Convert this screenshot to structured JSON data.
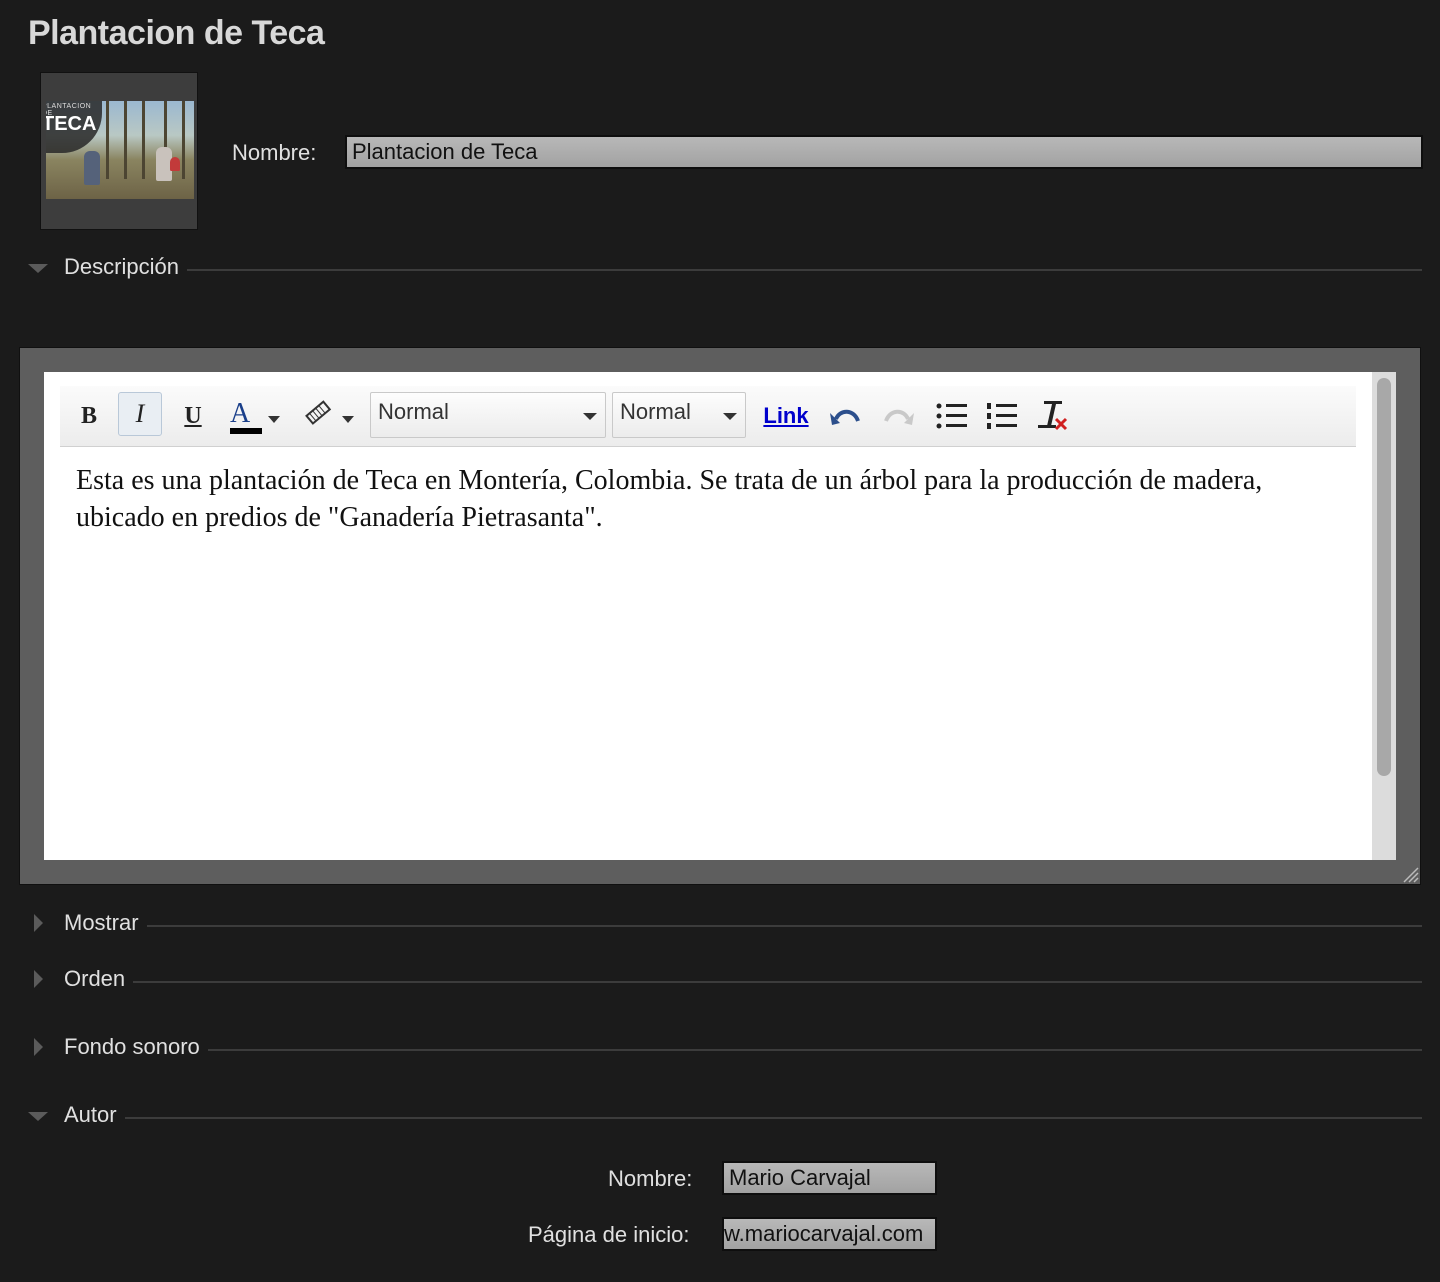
{
  "page": {
    "title": "Plantacion de Teca"
  },
  "thumbnail": {
    "badge_small": "PLANTACION DE",
    "badge_big": "TECA"
  },
  "name_field": {
    "label": "Nombre:",
    "value": "Plantacion de Teca"
  },
  "sections": {
    "descripcion": "Descripción",
    "mostrar": "Mostrar",
    "orden": "Orden",
    "fondo_sonoro": "Fondo sonoro",
    "autor": "Autor"
  },
  "editor": {
    "toolbar": {
      "bold": "B",
      "italic": "I",
      "underline": "U",
      "text_color_glyph": "A",
      "format_select": "Normal",
      "size_select": "Normal",
      "link": "Link"
    },
    "content": "Esta es una plantación de Teca en Montería, Colombia. Se trata de un árbol para la producción de madera, ubicado en predios de \"Ganadería Pietrasanta\"."
  },
  "author": {
    "name_label": "Nombre:",
    "name_value": "Mario Carvajal",
    "homepage_label": "Página de inicio:",
    "homepage_value": "w.mariocarvajal.com"
  },
  "colors": {
    "background": "#1b1b1b",
    "field": "#a8a8a8",
    "link": "#0000cc"
  }
}
